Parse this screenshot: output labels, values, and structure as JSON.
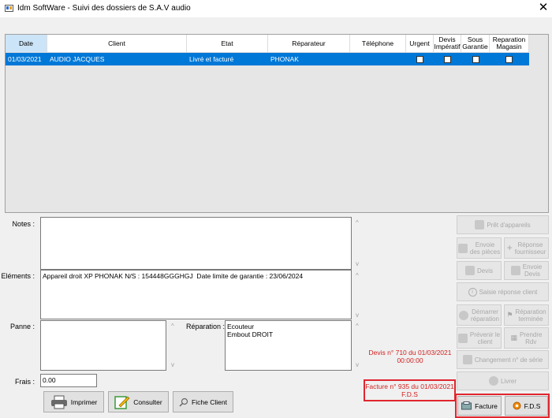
{
  "window": {
    "title": "Idm SoftWare - Suivi des dossiers de S.A.V audio"
  },
  "grid": {
    "columns": [
      "Date",
      "Client",
      "Etat",
      "Réparateur",
      "Téléphone",
      "Urgent",
      "Devis Impératif",
      "Sous Garantie",
      "Reparation Magasin"
    ],
    "rows": [
      {
        "date": "01/03/2021",
        "client": "AUDIO JACQUES",
        "etat": "Livré et facturé",
        "reparateur": "PHONAK",
        "telephone": ""
      }
    ]
  },
  "form": {
    "notes_label": "Notes :",
    "elements_label": "Eléments :",
    "elements_value": "Appareil droit XP PHONAK N/S : 154448GGGHGJ  Date limite de garantie : 23/06/2024",
    "panne_label": "Panne :",
    "reparation_label": "Réparation :",
    "reparation_line1": "Ecouteur",
    "reparation_line2": "Embout DROIT",
    "frais_label": "Frais :",
    "frais_value": "0.00"
  },
  "info": {
    "devis_line1": "Devis n° 710 du 01/03/2021",
    "devis_line2": "00:00:00",
    "facture_line1": "Facture n° 935 du 01/03/2021",
    "facture_line2": "F.D.S"
  },
  "buttons": {
    "imprimer": "Imprimer",
    "consulter": "Consulter",
    "fiche_client": "Fiche Client",
    "pret": "Prêt d'appareils",
    "envoie_pieces_1": "Envoie",
    "envoie_pieces_2": "des pièces",
    "reponse_fourn_1": "Réponse",
    "reponse_fourn_2": "fournisseur",
    "devis": "Devis",
    "envoie_devis_1": "Envoie",
    "envoie_devis_2": "Devis",
    "saisie_reponse": "Saisie réponse client",
    "demarrer_1": "Démarrer",
    "demarrer_2": "réparation",
    "rep_terminee_1": "Réparation",
    "rep_terminee_2": "terminée",
    "prevenir_1": "Prévenir le",
    "prevenir_2": "client",
    "prendre_1": "Prendre",
    "prendre_2": "Rdv",
    "changement_serie": "Changement n° de série",
    "livrer": "Livrer",
    "facture": "Facture",
    "fds": "F.D.S"
  },
  "colors": {
    "selection": "#0078d7",
    "highlight": "#e0262e",
    "info_text": "#d11f1f"
  }
}
